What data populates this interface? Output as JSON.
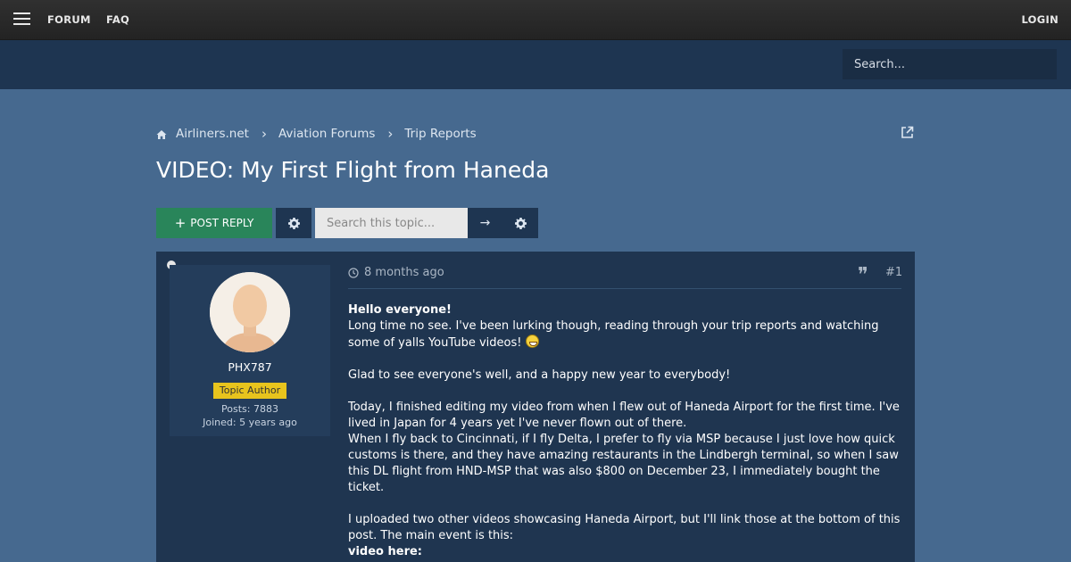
{
  "topbar": {
    "nav": [
      "FORUM",
      "FAQ"
    ],
    "login_label": "LOGIN"
  },
  "site_search": {
    "placeholder": "Search..."
  },
  "breadcrumb": [
    "Airliners.net",
    "Aviation Forums",
    "Trip Reports"
  ],
  "page_title": "VIDEO: My First Flight from Haneda",
  "actions": {
    "post_reply_label": "POST REPLY",
    "search_placeholder": "Search this topic..."
  },
  "post": {
    "time": "8 months ago",
    "number": "#1",
    "author": {
      "username": "PHX787",
      "badge": "Topic Author",
      "posts": "Posts: 7883",
      "joined": "Joined: 5 years ago"
    },
    "greeting": "Hello everyone!",
    "p1": "Long time no see. I've been lurking though, reading through your trip reports and watching some of yalls YouTube videos!",
    "p2": "Glad to see everyone's well, and a happy new year to everybody!",
    "p3a": "Today, I finished editing my video from when I flew out of Haneda Airport for the first time. I've lived in Japan for 4 years yet I've never flown out of there.",
    "p3b": "When I fly back to Cincinnati, if I fly Delta, I prefer to fly via MSP because I just love how quick customs is there, and they have amazing restaurants in the Lindbergh terminal, so when I saw this DL flight from HND-MSP that was also $800 on December 23, I immediately bought the ticket.",
    "p4": "I uploaded two other videos showcasing Haneda Airport, but I'll link those at the bottom of this post. The main event is this:",
    "video_label": "video here:"
  },
  "colors": {
    "page_bg": "#46698f",
    "post_bg": "#1f3550",
    "reply_button": "#29855a",
    "badge": "#e8c41d"
  }
}
